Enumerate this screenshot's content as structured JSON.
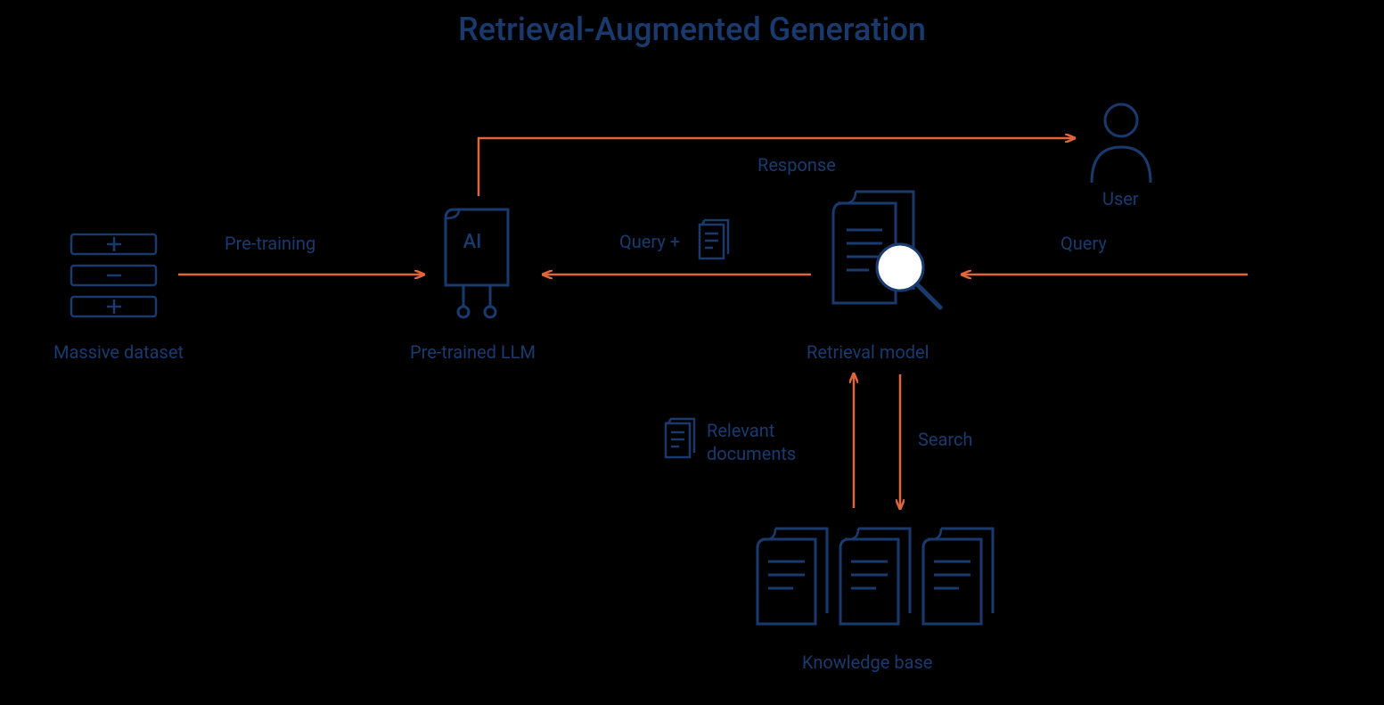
{
  "title": "Retrieval-Augmented Generation",
  "nodes": {
    "dataset": "Massive dataset",
    "llm": "Pre-trained LLM",
    "retrieval": "Retrieval model",
    "user": "User",
    "knowledge": "Knowledge base"
  },
  "edges": {
    "pretraining": "Pre-training",
    "query_plus": "Query +",
    "query": "Query",
    "response": "Response",
    "relevant_docs": "Relevant\ndocuments",
    "search": "Search"
  },
  "icons": {
    "ai_label": "AI"
  },
  "colors": {
    "navy": "#1a3a6e",
    "orange": "#e0653a"
  }
}
